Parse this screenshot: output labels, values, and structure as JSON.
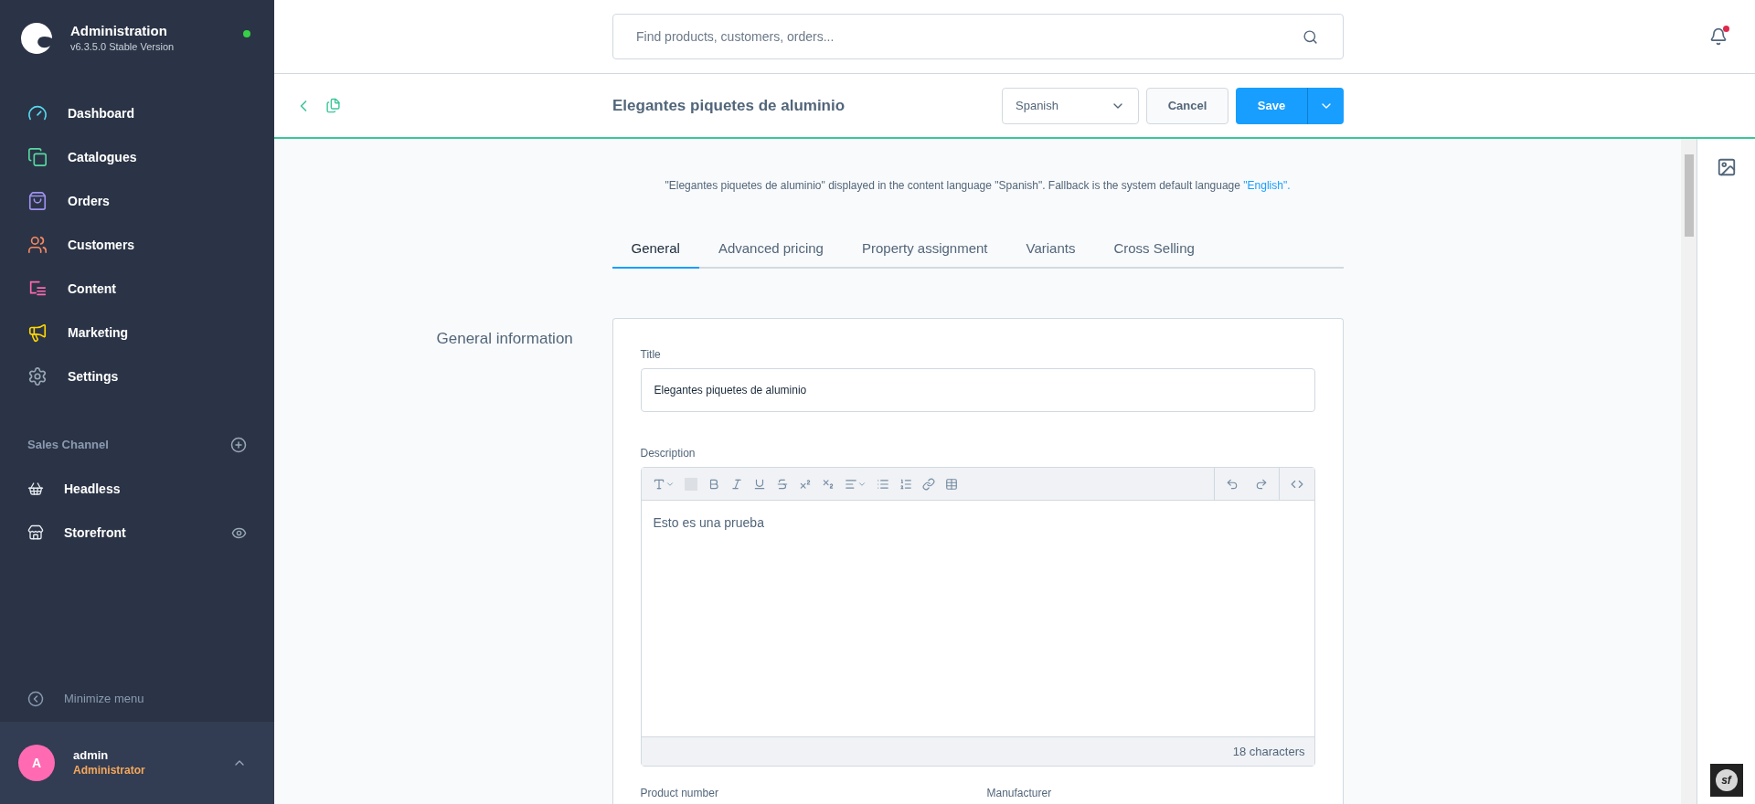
{
  "brand": {
    "title": "Administration",
    "version": "v6.3.5.0 Stable Version",
    "online": true
  },
  "nav": [
    {
      "label": "Dashboard",
      "kind": "gauge",
      "color": "#57d9f1",
      "selected": false
    },
    {
      "label": "Catalogues",
      "kind": "copy",
      "color": "#57d9a3",
      "selected": false
    },
    {
      "label": "Orders",
      "kind": "bag",
      "color": "#a092f0",
      "selected": false
    },
    {
      "label": "Customers",
      "kind": "users",
      "color": "#f88962",
      "selected": false
    },
    {
      "label": "Content",
      "kind": "content",
      "color": "#ff68b4",
      "selected": false
    },
    {
      "label": "Marketing",
      "kind": "megaphone",
      "color": "#ffd700",
      "selected": false
    },
    {
      "label": "Settings",
      "kind": "settings",
      "color": "#9aa8b5",
      "selected": false
    }
  ],
  "sales_channel": {
    "heading": "Sales Channel",
    "items": [
      {
        "label": "Headless",
        "kind": "basket",
        "visible_toggle": false
      },
      {
        "label": "Storefront",
        "kind": "store",
        "visible_toggle": true
      }
    ]
  },
  "minimize": "Minimize menu",
  "user": {
    "initial": "A",
    "name": "admin",
    "role": "Administrator"
  },
  "search": {
    "placeholder": "Find products, customers, orders..."
  },
  "notifications": {
    "unread": true
  },
  "toolbar": {
    "title": "Elegantes piquetes de aluminio",
    "language": "Spanish",
    "cancel": "Cancel",
    "save": "Save"
  },
  "notice": {
    "text": "\"Elegantes piquetes de aluminio\" displayed in the content language \"Spanish\". Fallback is the system default language ",
    "link": "\"English\"."
  },
  "tabs": [
    {
      "label": "General",
      "selected": true
    },
    {
      "label": "Advanced pricing",
      "selected": false
    },
    {
      "label": "Property assignment",
      "selected": false
    },
    {
      "label": "Variants",
      "selected": false
    },
    {
      "label": "Cross Selling",
      "selected": false
    }
  ],
  "section": {
    "heading": "General information",
    "title_label": "Title",
    "title_value": "Elegantes piquetes de aluminio",
    "description_label": "Description",
    "description_value": "Esto es una prueba",
    "char_count": "18 characters",
    "product_number_label": "Product number",
    "manufacturer_label": "Manufacturer"
  },
  "debug_badge": "sf"
}
